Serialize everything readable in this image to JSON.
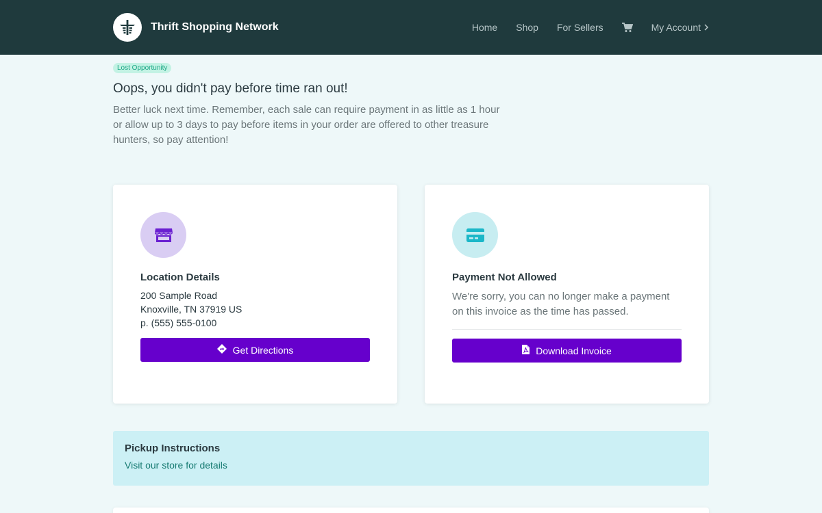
{
  "header": {
    "brand_name": "Thrift Shopping Network",
    "nav": {
      "home": "Home",
      "shop": "Shop",
      "for_sellers": "For Sellers",
      "my_account": "My Account"
    }
  },
  "status": {
    "badge": "Lost Opportunity",
    "title": "Oops, you didn't pay before time ran out!",
    "message": "Better luck next time. Remember, each sale can require payment in as little as 1 hour or allow up to 3 days to pay before items in your order are offered to other treasure hunters, so pay attention!"
  },
  "location_card": {
    "icon": "store-icon",
    "title": "Location Details",
    "address_line1": "200 Sample Road",
    "address_line2": "Knoxville, TN 37919 US",
    "phone": "p. (555) 555-0100",
    "button_label": "Get Directions"
  },
  "payment_card": {
    "icon": "credit-card-icon",
    "title": "Payment Not Allowed",
    "message": "We're sorry, you can no longer make a payment on this invoice as the time has passed.",
    "button_label": "Download Invoice"
  },
  "pickup": {
    "title": "Pickup Instructions",
    "link_text": "Visit our store for details"
  },
  "colors": {
    "navbar": "#1f3a3d",
    "accent": "#6600cc",
    "badge_bg": "#c3f2e4",
    "pickup_bg": "#ccf0f5"
  }
}
